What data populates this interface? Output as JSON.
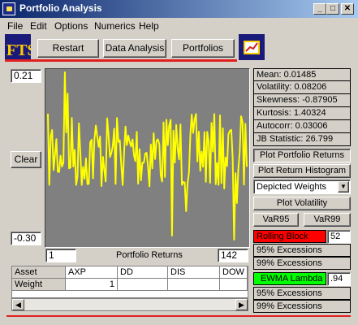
{
  "window": {
    "title": "Portfolio Analysis",
    "controls": {
      "minimize": "_",
      "maximize": "□",
      "close": "✕"
    }
  },
  "menu": [
    "File",
    "Edit",
    "Options",
    "Numerics",
    "Help"
  ],
  "toolbar": {
    "restart_label": "Restart",
    "data_analysis_label": "Data Analysis",
    "portfolios_label": "Portfolios",
    "logo_left_text": "FTS"
  },
  "plot": {
    "ymax_value": "0.21",
    "ymin_value": "-0.30",
    "clear_label": "Clear",
    "x_start_value": "1",
    "x_end_value": "142",
    "title": "Portfolio Returns",
    "line_color": "#ffff00",
    "bg_color": "#808080"
  },
  "stats": [
    "Mean: 0.01485",
    "Volatility: 0.08206",
    "Skewness: -0.87905",
    "Kurtosis: 1.40324",
    "Autocorr: 0.03006",
    "JB Statistic: 26.799"
  ],
  "controls": {
    "plot_portfolio_returns": "Plot Portfolio Returns",
    "plot_return_histogram": "Plot Return Histogram",
    "weights_select_value": "Depicted Weights",
    "plot_volatility": "Plot Volatility",
    "var95": "VaR95",
    "var99": "VaR99",
    "rolling_block_label": "Rolling Block",
    "rolling_block_value": "52",
    "excess_95_a": "95% Excessions",
    "excess_99_a": "99% Excessions",
    "ewma_label": "EWMA Lambda",
    "ewma_value": ".94",
    "excess_95_b": "95% Excessions",
    "excess_99_b": "99% Excessions",
    "rolling_color": "#ff0000",
    "ewma_color": "#00ff00"
  },
  "grid": {
    "headers": [
      "Asset",
      "AXP",
      "DD",
      "DIS",
      "DOW"
    ],
    "row_label": "Weight",
    "row_values": [
      "1",
      "",
      "",
      ""
    ]
  },
  "scrollbar": {
    "left_arrow": "◀",
    "right_arrow": "▶"
  }
}
